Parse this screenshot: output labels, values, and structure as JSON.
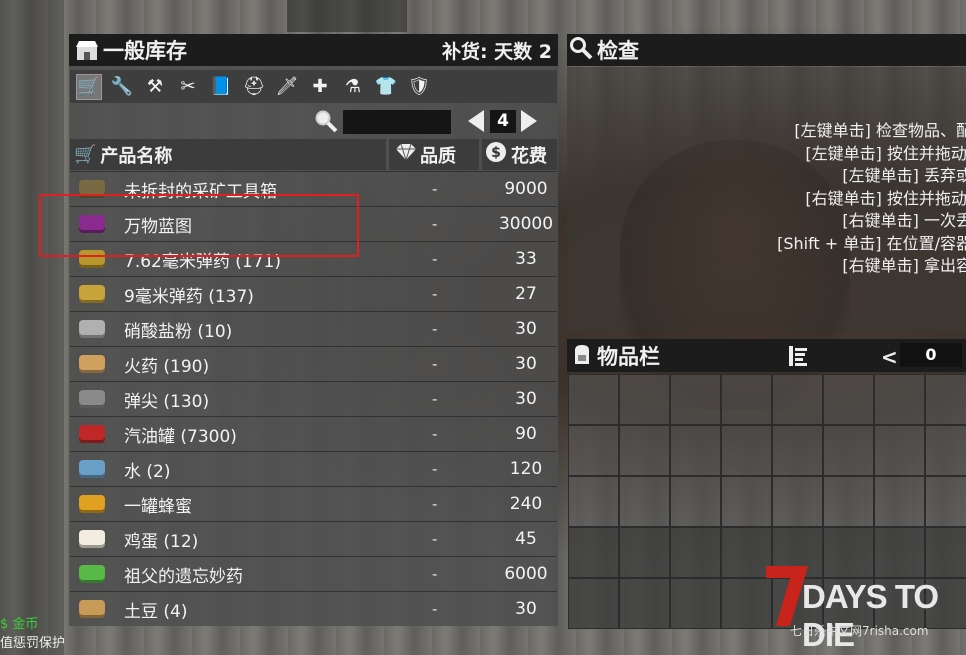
{
  "trader": {
    "title": "一般库存",
    "restock_label": "补货: 天数 2",
    "tabs": [
      "cart-icon",
      "wrench-icon",
      "hammer-icon",
      "tools-icon",
      "book-icon",
      "helmet-icon",
      "knife-icon",
      "medkit-icon",
      "flask-icon",
      "shirt-icon",
      "armor-icon"
    ],
    "page_number": "4",
    "search_placeholder": "",
    "columns": {
      "name": "产品名称",
      "quality": "品质",
      "cost": "花费"
    },
    "items": [
      {
        "name": "未拆封的采矿工具箱",
        "quality": "-",
        "cost": "9000",
        "icon": "toolbox-icon",
        "color": "#7a6a44"
      },
      {
        "name": "万物蓝图",
        "quality": "-",
        "cost": "30000",
        "icon": "blueprint-book-icon",
        "color": "#8a2a8e"
      },
      {
        "name": "7.62毫米弹药 (171)",
        "quality": "-",
        "cost": "33",
        "icon": "rifle-ammo-icon",
        "color": "#b8962e"
      },
      {
        "name": "9毫米弹药 (137)",
        "quality": "-",
        "cost": "27",
        "icon": "pistol-ammo-icon",
        "color": "#c8a23a"
      },
      {
        "name": "硝酸盐粉 (10)",
        "quality": "-",
        "cost": "30",
        "icon": "nitrate-jar-icon",
        "color": "#b0b0b0"
      },
      {
        "name": "火药 (190)",
        "quality": "-",
        "cost": "30",
        "icon": "gunpowder-icon",
        "color": "#d0a060"
      },
      {
        "name": "弹尖 (130)",
        "quality": "-",
        "cost": "30",
        "icon": "bullet-tip-icon",
        "color": "#8a8a8a"
      },
      {
        "name": "汽油罐 (7300)",
        "quality": "-",
        "cost": "90",
        "icon": "gas-can-icon",
        "color": "#c02828"
      },
      {
        "name": "水 (2)",
        "quality": "-",
        "cost": "120",
        "icon": "water-bottle-icon",
        "color": "#6aa0c8"
      },
      {
        "name": "一罐蜂蜜",
        "quality": "-",
        "cost": "240",
        "icon": "honey-jar-icon",
        "color": "#e0a020"
      },
      {
        "name": "鸡蛋 (12)",
        "quality": "-",
        "cost": "45",
        "icon": "egg-icon",
        "color": "#f2ede0"
      },
      {
        "name": "祖父的遗忘妙药",
        "quality": "-",
        "cost": "6000",
        "icon": "potion-bottle-icon",
        "color": "#58b848"
      },
      {
        "name": "土豆 (4)",
        "quality": "-",
        "cost": "30",
        "icon": "potato-icon",
        "color": "#c89a58"
      }
    ]
  },
  "inspect": {
    "title": "检查",
    "instructions": [
      "[左键单击] 检查物品、配",
      "[左键单击] 按住并拖动,",
      "[左键单击] 丢弃或",
      "[右键单击] 按住并拖动,",
      "[右键单击] 一次丢",
      "[Shift + 单击] 在位置/容器",
      "[右键单击] 拿出容"
    ]
  },
  "inventory": {
    "title": "物品栏",
    "count": "0"
  },
  "hud": {
    "coin_label": "金币",
    "penalty_label": "值惩罚保护"
  },
  "watermark": {
    "logo_text": "7DAYS TO DIE",
    "site_text": "七日杀中文网7risha.com"
  },
  "colors": {
    "highlight_box": "#e02020",
    "header_bg": "#1c1c1c",
    "panel_bg": "#4e4e4e"
  }
}
